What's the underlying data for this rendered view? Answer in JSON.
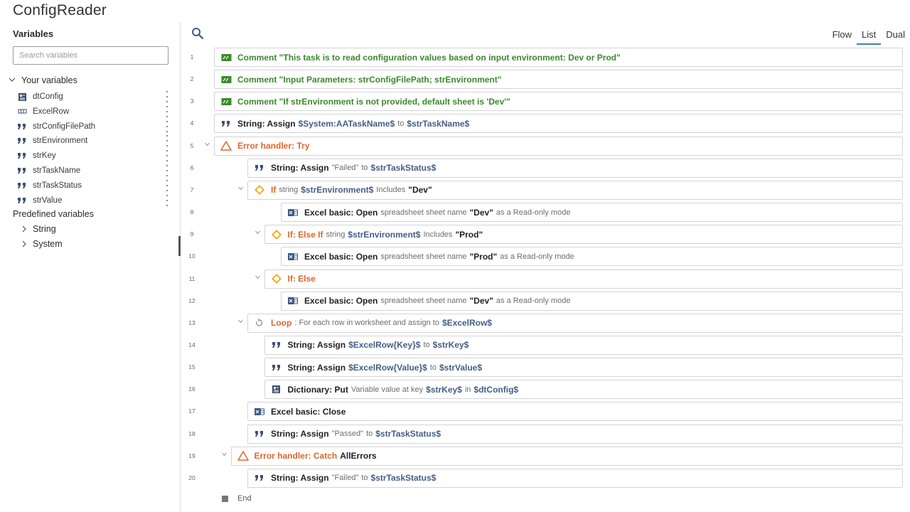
{
  "app": {
    "title": "ConfigReader"
  },
  "sidebar": {
    "heading": "Variables",
    "search_placeholder": "Search variables",
    "your_variables_label": "Your variables",
    "variables": [
      {
        "name": "dtConfig",
        "icon": "dictionary-icon"
      },
      {
        "name": "ExcelRow",
        "icon": "record-icon"
      },
      {
        "name": "strConfigFilePath",
        "icon": "string-icon"
      },
      {
        "name": "strEnvironment",
        "icon": "string-icon"
      },
      {
        "name": "strKey",
        "icon": "string-icon"
      },
      {
        "name": "strTaskName",
        "icon": "string-icon"
      },
      {
        "name": "strTaskStatus",
        "icon": "string-icon"
      },
      {
        "name": "strValue",
        "icon": "string-icon"
      }
    ],
    "predefined_label": "Predefined variables",
    "predefined": [
      {
        "name": "String"
      },
      {
        "name": "System"
      }
    ]
  },
  "toolbar": {
    "tabs": [
      {
        "label": "Flow",
        "active": false
      },
      {
        "label": "List",
        "active": true
      },
      {
        "label": "Dual",
        "active": false
      }
    ]
  },
  "colors": {
    "comment": "#3a8a2c",
    "control": "#e0662b",
    "variable": "#445e86",
    "accent": "#4a7ab3"
  },
  "steps": [
    {
      "n": "1",
      "depth": 0,
      "icon": "comment-icon",
      "kind": "comment",
      "parts": [
        [
          "cmt",
          "Comment \"This task is to read configuration values based on input environment: Dev or Prod\""
        ]
      ]
    },
    {
      "n": "2",
      "depth": 0,
      "icon": "comment-icon",
      "kind": "comment",
      "parts": [
        [
          "cmt",
          "Comment \"Input Parameters: strConfigFilePath; strEnvironment\""
        ]
      ]
    },
    {
      "n": "3",
      "depth": 0,
      "icon": "comment-icon",
      "kind": "comment",
      "parts": [
        [
          "cmt",
          "Comment \"If strEnvironment is not provided, default sheet is 'Dev'\""
        ]
      ]
    },
    {
      "n": "4",
      "depth": 0,
      "icon": "string-icon",
      "kind": "action",
      "parts": [
        [
          "b",
          "String: Assign"
        ],
        [
          "v",
          "$System:AATaskName$"
        ],
        [
          "g",
          "to"
        ],
        [
          "v",
          "$strTaskName$"
        ]
      ]
    },
    {
      "n": "5",
      "depth": 0,
      "icon": "error-handler-icon",
      "kind": "control",
      "fold": true,
      "parts": [
        [
          "or",
          "Error handler: Try"
        ]
      ]
    },
    {
      "n": "6",
      "depth": 1,
      "icon": "string-icon",
      "kind": "action",
      "parts": [
        [
          "b",
          "String: Assign"
        ],
        [
          "g",
          "\"Failed\""
        ],
        [
          "g",
          "to"
        ],
        [
          "v",
          "$strTaskStatus$"
        ]
      ]
    },
    {
      "n": "7",
      "depth": 1,
      "icon": "if-icon",
      "kind": "control",
      "fold": true,
      "parts": [
        [
          "or",
          "If"
        ],
        [
          "g",
          "string"
        ],
        [
          "v",
          "$strEnvironment$"
        ],
        [
          "g",
          "Includes"
        ],
        [
          "b",
          "\"Dev\""
        ]
      ]
    },
    {
      "n": "8",
      "depth": 2,
      "icon": "excel-icon",
      "kind": "action",
      "parts": [
        [
          "b",
          "Excel basic: Open"
        ],
        [
          "g",
          "spreadsheet sheet name"
        ],
        [
          "b",
          "\"Dev\""
        ],
        [
          "g",
          "as a Read-only mode"
        ]
      ]
    },
    {
      "n": "9",
      "depth": 1.5,
      "icon": "if-icon",
      "kind": "control",
      "fold": true,
      "parts": [
        [
          "or",
          "If: Else If"
        ],
        [
          "g",
          "string"
        ],
        [
          "v",
          "$strEnvironment$"
        ],
        [
          "g",
          "Includes"
        ],
        [
          "b",
          "\"Prod\""
        ]
      ]
    },
    {
      "n": "10",
      "depth": 2,
      "icon": "excel-icon",
      "kind": "action",
      "parts": [
        [
          "b",
          "Excel basic: Open"
        ],
        [
          "g",
          "spreadsheet sheet name"
        ],
        [
          "b",
          "\"Prod\""
        ],
        [
          "g",
          "as a Read-only mode"
        ]
      ]
    },
    {
      "n": "11",
      "depth": 1.5,
      "icon": "if-icon",
      "kind": "control",
      "fold": true,
      "parts": [
        [
          "or",
          "If: Else"
        ]
      ]
    },
    {
      "n": "12",
      "depth": 2,
      "icon": "excel-icon",
      "kind": "action",
      "parts": [
        [
          "b",
          "Excel basic: Open"
        ],
        [
          "g",
          "spreadsheet sheet name"
        ],
        [
          "b",
          "\"Dev\""
        ],
        [
          "g",
          "as a Read-only mode"
        ]
      ]
    },
    {
      "n": "13",
      "depth": 1,
      "icon": "loop-icon",
      "kind": "control",
      "fold": true,
      "parts": [
        [
          "or",
          "Loop"
        ],
        [
          "g",
          ": For each row in worksheet and assign to"
        ],
        [
          "v",
          "$ExcelRow$"
        ]
      ]
    },
    {
      "n": "14",
      "depth": 1.5,
      "icon": "string-icon",
      "kind": "action",
      "parts": [
        [
          "b",
          "String: Assign"
        ],
        [
          "v",
          "$ExcelRow{Key}$"
        ],
        [
          "g",
          "to"
        ],
        [
          "v",
          "$strKey$"
        ]
      ]
    },
    {
      "n": "15",
      "depth": 1.5,
      "icon": "string-icon",
      "kind": "action",
      "parts": [
        [
          "b",
          "String: Assign"
        ],
        [
          "v",
          "$ExcelRow{Value}$"
        ],
        [
          "g",
          "to"
        ],
        [
          "v",
          "$strValue$"
        ]
      ]
    },
    {
      "n": "16",
      "depth": 1.5,
      "icon": "dictionary-icon",
      "kind": "action",
      "parts": [
        [
          "b",
          "Dictionary: Put"
        ],
        [
          "g",
          "Variable value at key"
        ],
        [
          "v",
          "$strKey$"
        ],
        [
          "g",
          "in"
        ],
        [
          "v",
          "$dtConfig$"
        ]
      ]
    },
    {
      "n": "17",
      "depth": 1,
      "icon": "excel-icon",
      "kind": "action",
      "parts": [
        [
          "b",
          "Excel basic: Close"
        ]
      ]
    },
    {
      "n": "18",
      "depth": 1,
      "icon": "string-icon",
      "kind": "action",
      "parts": [
        [
          "b",
          "String: Assign"
        ],
        [
          "g",
          "\"Passed\""
        ],
        [
          "g",
          "to"
        ],
        [
          "v",
          "$strTaskStatus$"
        ]
      ]
    },
    {
      "n": "19",
      "depth": 0.5,
      "icon": "error-handler-icon",
      "kind": "control",
      "fold": true,
      "parts": [
        [
          "or",
          "Error handler: Catch"
        ],
        [
          "b2",
          "AllErrors"
        ]
      ]
    },
    {
      "n": "20",
      "depth": 1,
      "icon": "string-icon",
      "kind": "action",
      "parts": [
        [
          "b",
          "String: Assign"
        ],
        [
          "g",
          "\"Failed\""
        ],
        [
          "g",
          "to"
        ],
        [
          "v",
          "$strTaskStatus$"
        ]
      ]
    }
  ],
  "end_label": "End"
}
